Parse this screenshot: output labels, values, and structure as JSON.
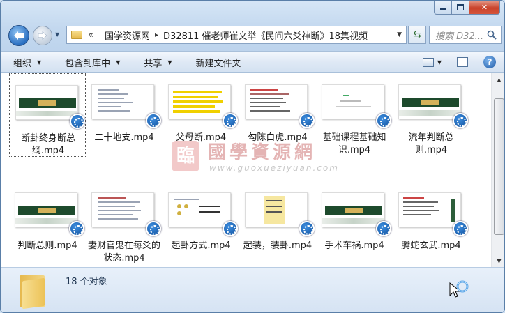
{
  "window": {
    "caption": {
      "minimize": "minimize",
      "maximize": "maximize",
      "close": "✕"
    }
  },
  "nav": {
    "breadcrumb": [
      {
        "label": "«"
      },
      {
        "label": "国学资源网"
      },
      {
        "label": "D32811 催老师崔文举《民间六爻神断》18集视频"
      }
    ],
    "separator": "▸",
    "search_placeholder": "搜索 D32...",
    "refresh_glyph": "⇆"
  },
  "toolbar": {
    "items": [
      {
        "label": "组织",
        "has_dropdown": true
      },
      {
        "label": "包含到库中",
        "has_dropdown": true
      },
      {
        "label": "共享",
        "has_dropdown": true
      },
      {
        "label": "新建文件夹",
        "has_dropdown": false
      }
    ],
    "dropdown_glyph": "▼",
    "help_glyph": "?"
  },
  "files": [
    {
      "name": "断卦终身断总纲.mp4",
      "thumb": "green",
      "selected": true
    },
    {
      "name": "二十地支.mp4",
      "thumb": "text"
    },
    {
      "name": "父母断.mp4",
      "thumb": "yellow"
    },
    {
      "name": "勾陈白虎.mp4",
      "thumb": "red"
    },
    {
      "name": "基础课程基础知识.mp4",
      "thumb": "text"
    },
    {
      "name": "流年判断总则.mp4",
      "thumb": "green"
    },
    {
      "name": "判断总则.mp4",
      "thumb": "green"
    },
    {
      "name": "妻财官鬼在每爻的状态.mp4",
      "thumb": "text"
    },
    {
      "name": "起卦方式.mp4",
      "thumb": "text"
    },
    {
      "name": "起装，装卦.mp4",
      "thumb": "yellow"
    },
    {
      "name": "手术车祸.mp4",
      "thumb": "green"
    },
    {
      "name": "腾蛇玄武.mp4",
      "thumb": "red"
    }
  ],
  "watermark": {
    "seal": "臨",
    "main": "國學資源網",
    "url": "www.guoxueziyuan.com"
  },
  "status": {
    "count_text": "18 个对象"
  },
  "colors": {
    "accent": "#2a6fc1",
    "close_red": "#c8412a",
    "folder_yellow": "#ecc257"
  }
}
